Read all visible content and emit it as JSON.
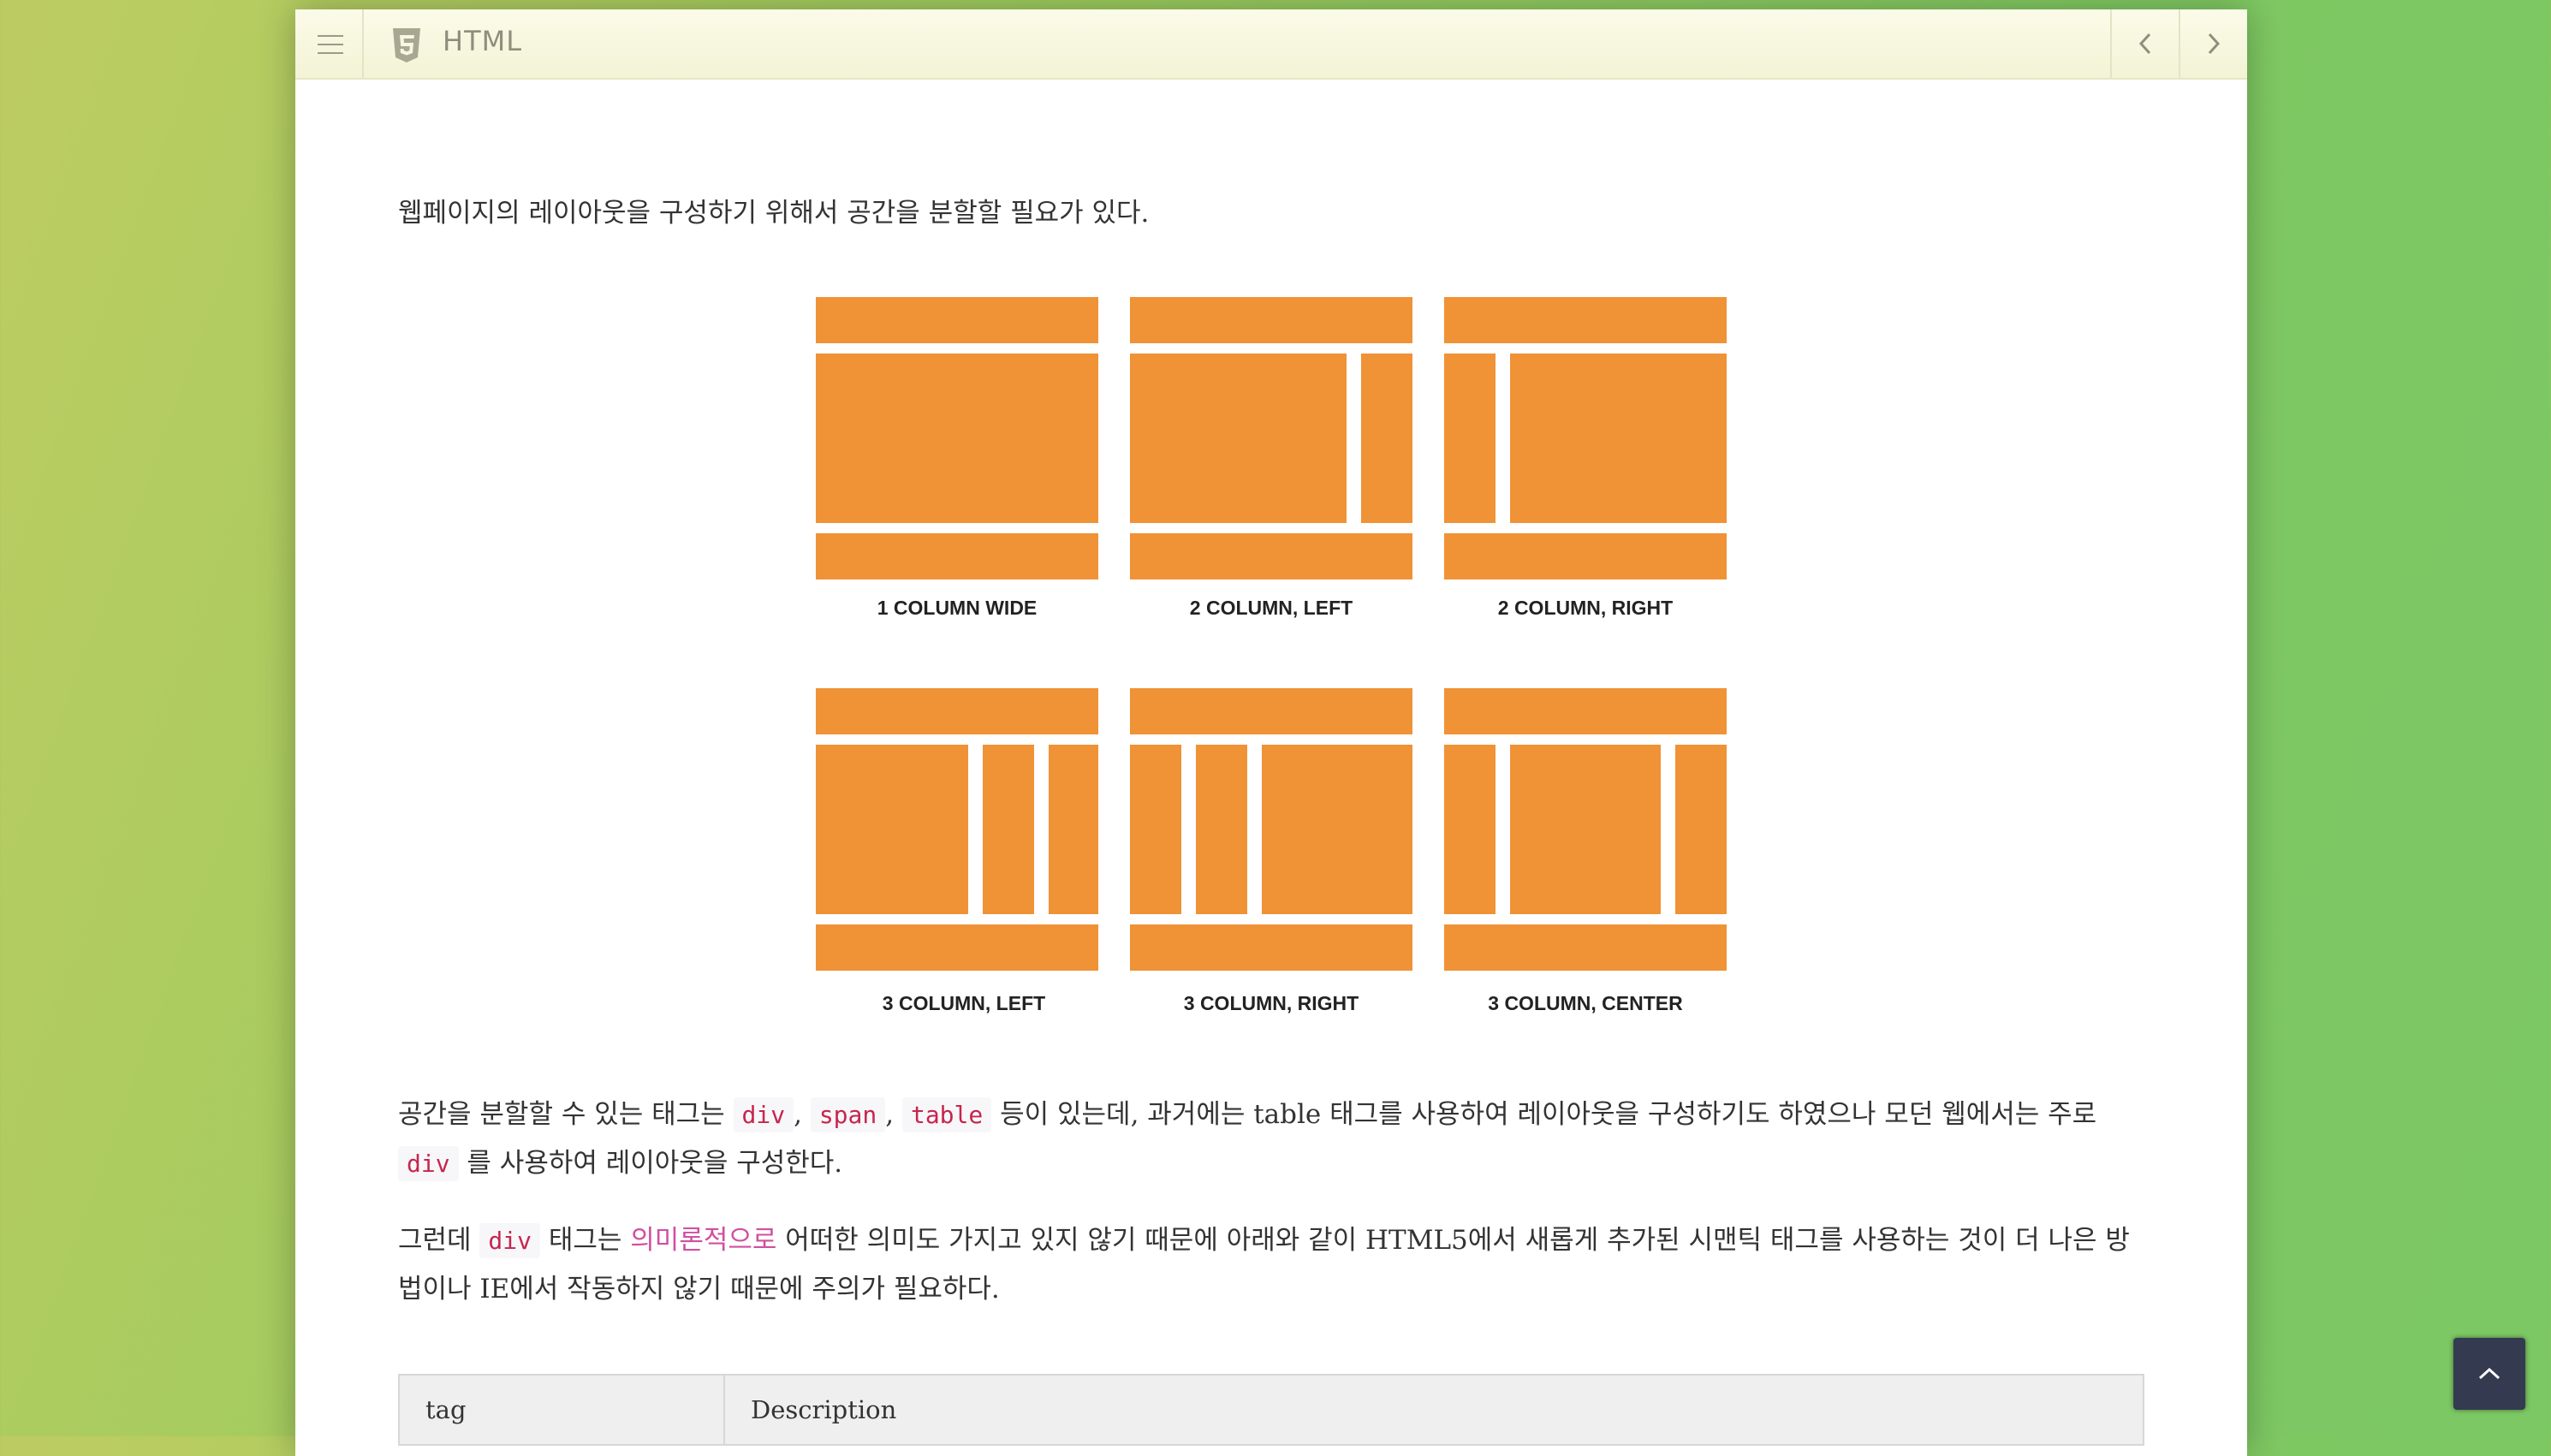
{
  "topbar": {
    "title": "HTML",
    "icons": [
      "menu-icon",
      "html5-icon",
      "chevron-left-icon",
      "chevron-right-icon"
    ]
  },
  "content": {
    "intro": "웹페이지의 레이아웃을 구성하기 위해서 공간을 분할할 필요가 있다.",
    "layouts": [
      {
        "label": "1 COLUMN WIDE"
      },
      {
        "label": "2 COLUMN, LEFT"
      },
      {
        "label": "2 COLUMN, RIGHT"
      },
      {
        "label": "3 COLUMN, LEFT"
      },
      {
        "label": "3 COLUMN, RIGHT"
      },
      {
        "label": "3 COLUMN, CENTER"
      }
    ],
    "p2": {
      "t1": "공간을 분할할 수 있는 태그는 ",
      "c1": "div",
      "s1": ", ",
      "c2": "span",
      "s2": ", ",
      "c3": "table",
      "t2": " 등이 있는데, 과거에는 table 태그를 사용하여 레이아웃을 구성하기도 하였으나 모던 웹에서는 주로 ",
      "c4": "div",
      "t3": " 를 사용하여 레이아웃을 구성한다."
    },
    "p3": {
      "t1": "그런데 ",
      "c1": "div",
      "t2": " 태그는 ",
      "link": "의미론적으로",
      "t3": " 어떠한 의미도 가지고 있지 않기 때문에 아래와 같이 HTML5에서 새롭게 추가된 시맨틱 태그를 사용하는 것이 더 나은 방법이나 IE에서 작동하지 않기 때문에 주의가 필요하다."
    },
    "table": {
      "headers": [
        "tag",
        "Description"
      ]
    }
  },
  "colors": {
    "layout_block": "#f09236",
    "link": "#d14fa0",
    "code": "#c7254e",
    "back_to_top": "#343a4f"
  }
}
